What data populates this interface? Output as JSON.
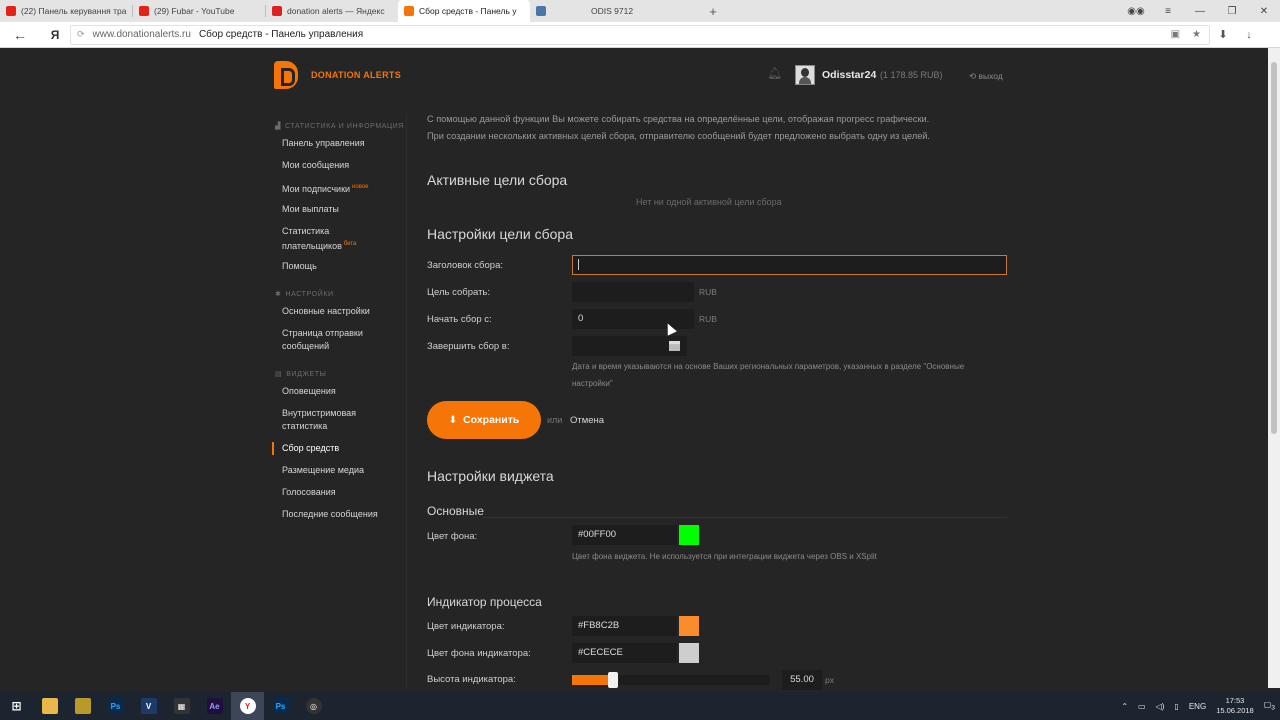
{
  "browser": {
    "tabs": [
      {
        "title": "(22) Панель керування тра",
        "icon_color": "#e62117"
      },
      {
        "title": "(29) Fubar - YouTube",
        "icon_color": "#e62117"
      },
      {
        "title": "donation alerts — Яндекс",
        "icon_color": "#e01f1f"
      },
      {
        "title": "Сбор средств - Панель у",
        "icon_color": "#f57507",
        "active": true
      },
      {
        "title": "",
        "icon_color": "#4a76a8"
      },
      {
        "title": "ODIS 9712",
        "icon_color": "#e4e4e4"
      }
    ],
    "host": "www.donationalerts.ru",
    "page_title": "Сбор средств - Панель управления",
    "yandex_logo": "Я"
  },
  "header": {
    "logo_text": "DONATION ALERTS",
    "username": "Odisstar24",
    "balance": "(1 178.85 RUB)",
    "logout": "выход"
  },
  "sidebar": {
    "sections": [
      {
        "title": "Статистика и информация",
        "items": [
          {
            "label": "Панель управления"
          },
          {
            "label": "Мои сообщения"
          },
          {
            "label": "Мои подписчики",
            "badge": "новое"
          },
          {
            "label": "Мои выплаты"
          },
          {
            "label": "Статистика плательщиков",
            "badge": "бета"
          },
          {
            "label": "Помощь"
          }
        ]
      },
      {
        "title": "Настройки",
        "items": [
          {
            "label": "Основные настройки"
          },
          {
            "label": "Страница отправки сообщений"
          }
        ]
      },
      {
        "title": "Виджеты",
        "items": [
          {
            "label": "Оповещения"
          },
          {
            "label": "Внутристримовая статистика"
          },
          {
            "label": "Сбор средств",
            "active": true
          },
          {
            "label": "Размещение медиа"
          },
          {
            "label": "Голосования"
          },
          {
            "label": "Последние сообщения"
          }
        ]
      }
    ]
  },
  "main": {
    "intro_line1": "С помощью данной функции Вы можете собирать средства на определённые цели, отображая прогресс графически.",
    "intro_line2": "При создании нескольких активных целей сбора, отправителю сообщений будет предложено выбрать одну из целей.",
    "active_title": "Активные цели сбора",
    "active_empty": "Нет ни одной активной цели сбора",
    "settings_title": "Настройки цели сбора",
    "form": {
      "title_label": "Заголовок сбора:",
      "title_value": "",
      "goal_label": "Цель собрать:",
      "goal_value": "",
      "goal_unit": "RUB",
      "start_label": "Начать сбор с:",
      "start_value": "0",
      "start_unit": "RUB",
      "end_label": "Завершить сбор в:",
      "end_value": "",
      "date_hint": "Дата и время указываются на основе Ваших региональных параметров, указанных в разделе \"Основные настройки\""
    },
    "save_label": "Сохранить",
    "or_text": "или",
    "cancel_label": "Отмена",
    "widget_title": "Настройки виджета",
    "basic_title": "Основные",
    "bg_color_label": "Цвет фона:",
    "bg_color_value": "#00FF00",
    "bg_color_display": "#00FF00",
    "bg_hint": "Цвет фона виджета. Не используется при интеграции виджета через OBS и XSplit",
    "progress_title": "Индикатор процесса",
    "ind_color_label": "Цвет индикатора:",
    "ind_color_value": "#FB8C2B",
    "ind_color_display": "#FB8C2B",
    "ind_bg_label": "Цвет фона индикатора:",
    "ind_bg_value": "#CECECE",
    "ind_bg_display": "#CECECE",
    "height_label": "Высота индикатора:",
    "height_value": "55.00",
    "height_unit": "px",
    "height_fraction": 0.18
  },
  "taskbar": {
    "lang": "ENG",
    "time": "17:53",
    "date": "15.06.2018",
    "notif_count": "3"
  },
  "colors": {
    "accent": "#f57507",
    "bg": "#252525"
  }
}
